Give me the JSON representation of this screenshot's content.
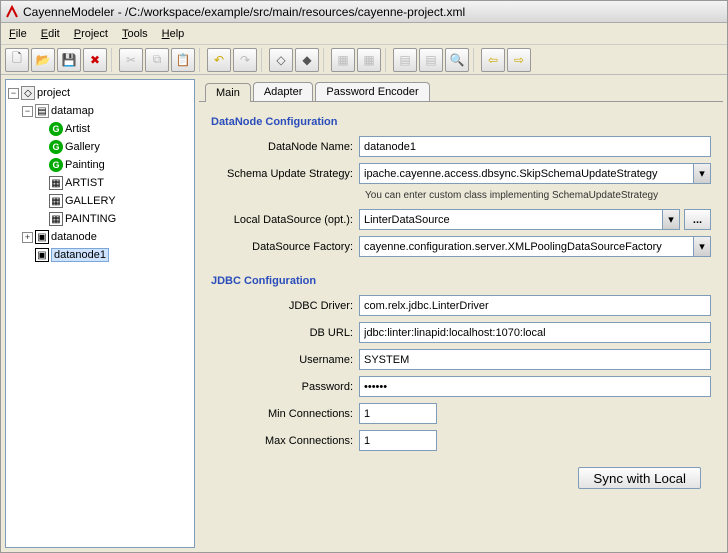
{
  "window": {
    "title": "CayenneModeler - /C:/workspace/example/src/main/resources/cayenne-project.xml"
  },
  "menu": {
    "file": "File",
    "edit": "Edit",
    "project": "Project",
    "tools": "Tools",
    "help": "Help"
  },
  "toolbar_icons": {
    "new": "new",
    "open": "open",
    "save": "save",
    "delete": "delete",
    "cut": "cut",
    "copy": "copy",
    "paste": "paste",
    "undo": "undo",
    "redo": "redo",
    "dm": "dm",
    "dn": "dn",
    "b1": "b1",
    "b2": "b2",
    "b3": "b3",
    "b4": "b4",
    "zoom": "zoom",
    "back": "back",
    "forward": "forward"
  },
  "tree": {
    "root": "project",
    "datamap": "datamap",
    "objs": {
      "artist": "Artist",
      "gallery": "Gallery",
      "painting": "Painting"
    },
    "dbs": {
      "artist": "ARTIST",
      "gallery": "GALLERY",
      "painting": "PAINTING"
    },
    "datanode": "datanode",
    "datanode1": "datanode1"
  },
  "tabs": {
    "main": "Main",
    "adapter": "Adapter",
    "pwenc": "Password Encoder"
  },
  "sections": {
    "datanode": "DataNode Configuration",
    "jdbc": "JDBC Configuration"
  },
  "labels": {
    "name": "DataNode Name:",
    "strategy": "Schema Update Strategy:",
    "hint": "You can enter custom class implementing SchemaUpdateStrategy",
    "localds": "Local DataSource (opt.):",
    "dsf": "DataSource Factory:",
    "driver": "JDBC Driver:",
    "url": "DB URL:",
    "user": "Username:",
    "pass": "Password:",
    "min": "Min Connections:",
    "max": "Max Connections:",
    "sync": "Sync with Local"
  },
  "values": {
    "name": "datanode1",
    "strategy": "ipache.cayenne.access.dbsync.SkipSchemaUpdateStrategy",
    "localds": "LinterDataSource",
    "dsf": "cayenne.configuration.server.XMLPoolingDataSourceFactory",
    "driver": "com.relx.jdbc.LinterDriver",
    "url": "jdbc:linter:linapid:localhost:1070:local",
    "user": "SYSTEM",
    "pass": "••••••",
    "min": "1",
    "max": "1"
  }
}
